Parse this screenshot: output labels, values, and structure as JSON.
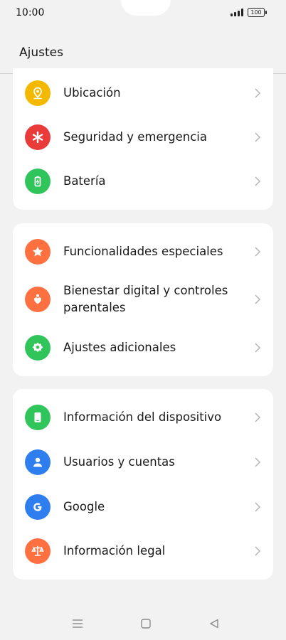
{
  "status_bar": {
    "time": "10:00",
    "battery": "100"
  },
  "header": {
    "title": "Ajustes"
  },
  "colors": {
    "ubicacion": "#f5b800",
    "seguridad": "#ea3b3b",
    "bateria": "#2fc55a",
    "funcionalidades": "#ff7040",
    "bienestar": "#ff7040",
    "adicionales": "#2fc55a",
    "dispositivo": "#2fc55a",
    "usuarios": "#2f7ef0",
    "google": "#2f7ef0",
    "legal": "#ff7040"
  },
  "group1": {
    "items": [
      {
        "label": "Ubicación",
        "icon": "location-pin-icon"
      },
      {
        "label": "Seguridad y emergencia",
        "icon": "asterisk-icon"
      },
      {
        "label": "Batería",
        "icon": "battery-icon"
      }
    ]
  },
  "group2": {
    "items": [
      {
        "label": "Funcionalidades especiales",
        "icon": "star-icon"
      },
      {
        "label": "Bienestar digital y controles parentales",
        "icon": "heart-person-icon"
      },
      {
        "label": "Ajustes adicionales",
        "icon": "gear-icon"
      }
    ]
  },
  "group3": {
    "items": [
      {
        "label": "Información del dispositivo",
        "icon": "phone-icon"
      },
      {
        "label": "Usuarios y cuentas",
        "icon": "user-icon"
      },
      {
        "label": "Google",
        "icon": "google-icon"
      },
      {
        "label": "Información legal",
        "icon": "scales-icon"
      }
    ]
  },
  "navigation_bar": {
    "buttons": [
      "menu-icon",
      "home-icon",
      "back-icon"
    ]
  }
}
